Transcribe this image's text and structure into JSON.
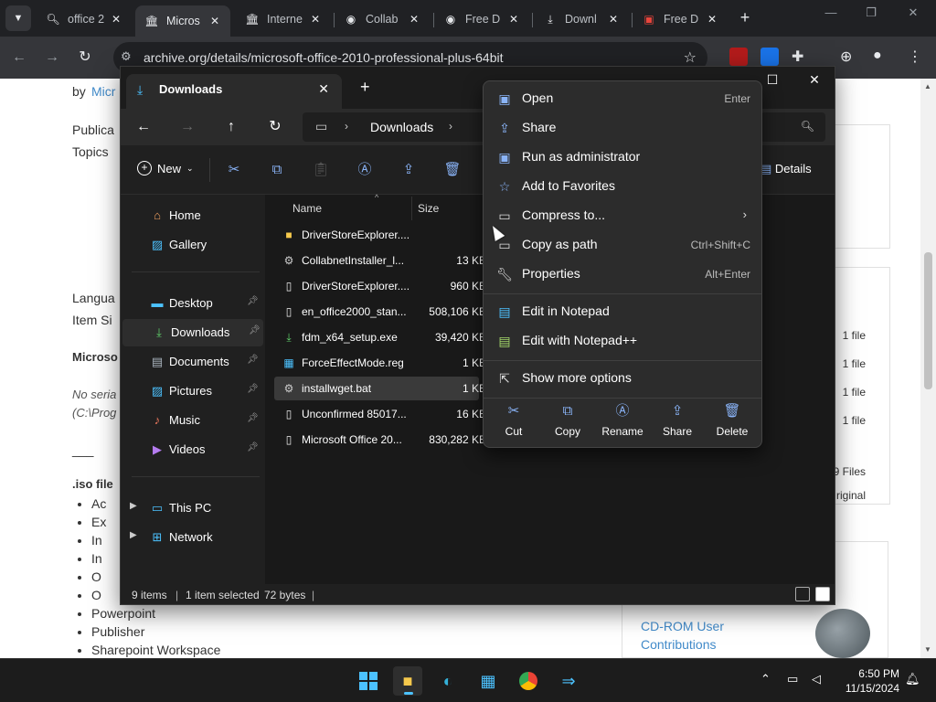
{
  "browser": {
    "tabs": [
      {
        "title": "office 2",
        "icon": "search-icon",
        "active": false
      },
      {
        "title": "Micros",
        "icon": "archive-icon",
        "active": true
      },
      {
        "title": "Interne",
        "icon": "archive-icon",
        "active": false
      },
      {
        "title": "Collab",
        "icon": "globe-icon",
        "active": false
      },
      {
        "title": "Free D",
        "icon": "globe-icon",
        "active": false
      },
      {
        "title": "Downl",
        "icon": "download-icon",
        "active": false
      },
      {
        "title": "Free D",
        "icon": "pdf-icon",
        "active": false
      }
    ],
    "url": "archive.org/details/microsoft-office-2010-professional-plus-64bit"
  },
  "page": {
    "by_prefix": "by",
    "by_link": "Micr",
    "publica": "Publica",
    "topics": "Topics",
    "langua": "Langua",
    "item_si": "Item Si",
    "microso": "Microso",
    "no_seria": "No seria",
    "c_prog": "(C:\\Prog",
    "dash": "___",
    "iso_file": ".iso file",
    "bullets": [
      "Ac",
      "Ex",
      "In",
      "In",
      "O",
      "O",
      "Powerpoint",
      "Publisher",
      "Sharepoint Workspace"
    ],
    "side_rows": [
      "1 file",
      "1 file",
      "1 file",
      "1 file"
    ],
    "files_9": "9 Files",
    "original": "riginal",
    "cdrom_line1": "CD-ROM User",
    "cdrom_line2": "Contributions"
  },
  "explorer": {
    "tab_title": "Downloads",
    "breadcrumb": "Downloads",
    "toolbar": {
      "new_label": "New",
      "details_label": "Details"
    },
    "nav": {
      "home": "Home",
      "gallery": "Gallery",
      "desktop": "Desktop",
      "downloads": "Downloads",
      "documents": "Documents",
      "pictures": "Pictures",
      "music": "Music",
      "videos": "Videos",
      "this_pc": "This PC",
      "network": "Network"
    },
    "columns": {
      "name": "Name",
      "size": "Size"
    },
    "files": [
      {
        "name": "DriverStoreExplorer....",
        "size": "",
        "icon": "folder-icon"
      },
      {
        "name": "CollabnetInstaller_l...",
        "size": "13 KB",
        "icon": "exe-icon"
      },
      {
        "name": "DriverStoreExplorer....",
        "size": "960 KB",
        "icon": "file-icon"
      },
      {
        "name": "en_office2000_stan...",
        "size": "508,106 KB",
        "icon": "file-icon"
      },
      {
        "name": "fdm_x64_setup.exe",
        "size": "39,420 KB",
        "icon": "installer-icon"
      },
      {
        "name": "ForceEffectMode.reg",
        "size": "1 KB",
        "icon": "registry-icon"
      },
      {
        "name": "installwget.bat",
        "size": "1 KB",
        "icon": "batch-icon"
      },
      {
        "name": "Unconfirmed 85017...",
        "size": "16 KB",
        "icon": "file-icon"
      },
      {
        "name": "Microsoft Office 20...",
        "size": "830,282 KB",
        "icon": "file-icon"
      }
    ],
    "status": {
      "items": "9 items",
      "selected": "1 item selected",
      "bytes": "72 bytes"
    }
  },
  "context_menu": {
    "open": "Open",
    "open_shortcut": "Enter",
    "share": "Share",
    "run_admin": "Run as administrator",
    "add_fav": "Add to Favorites",
    "compress": "Compress to...",
    "copy_path": "Copy as path",
    "copy_path_shortcut": "Ctrl+Shift+C",
    "properties": "Properties",
    "properties_shortcut": "Alt+Enter",
    "edit_notepad": "Edit in Notepad",
    "edit_notepadpp": "Edit with Notepad++",
    "more_options": "Show more options",
    "quick": {
      "cut": "Cut",
      "copy": "Copy",
      "rename": "Rename",
      "share": "Share",
      "delete": "Delete"
    }
  },
  "taskbar": {
    "time": "6:50 PM",
    "date": "11/15/2024"
  }
}
